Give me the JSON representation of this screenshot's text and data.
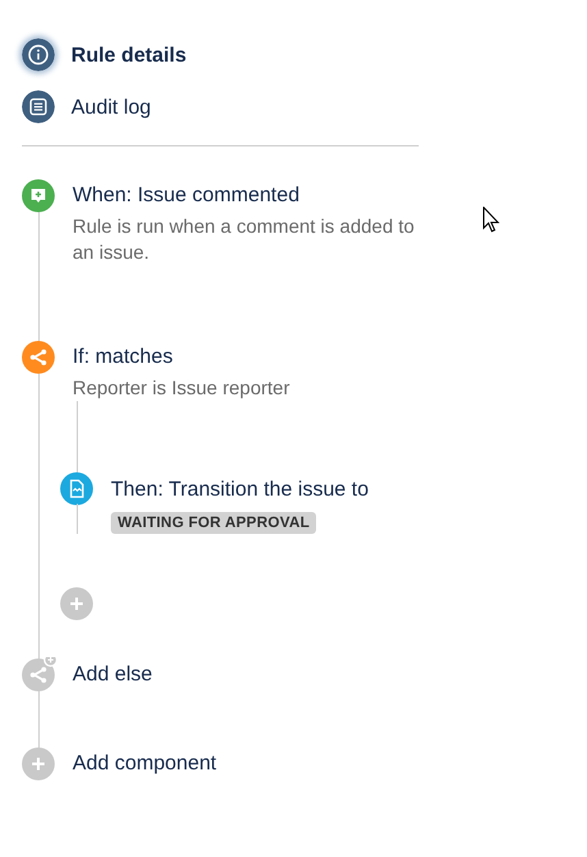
{
  "nav": [
    {
      "label": "Rule details",
      "kind": "info",
      "selected": true
    },
    {
      "label": "Audit log",
      "kind": "log",
      "selected": false
    }
  ],
  "steps": [
    {
      "kind": "trigger",
      "title": "When: Issue commented",
      "description": "Rule is run when a comment is added to an issue."
    },
    {
      "kind": "condition",
      "title": "If: matches",
      "description": "Reporter is Issue reporter",
      "children": [
        {
          "kind": "action",
          "title": "Then: Transition the issue to",
          "tag": "WAITING FOR APPROVAL"
        },
        {
          "kind": "add"
        }
      ]
    },
    {
      "kind": "add_else",
      "title": "Add else"
    },
    {
      "kind": "add_component",
      "title": "Add component"
    }
  ]
}
